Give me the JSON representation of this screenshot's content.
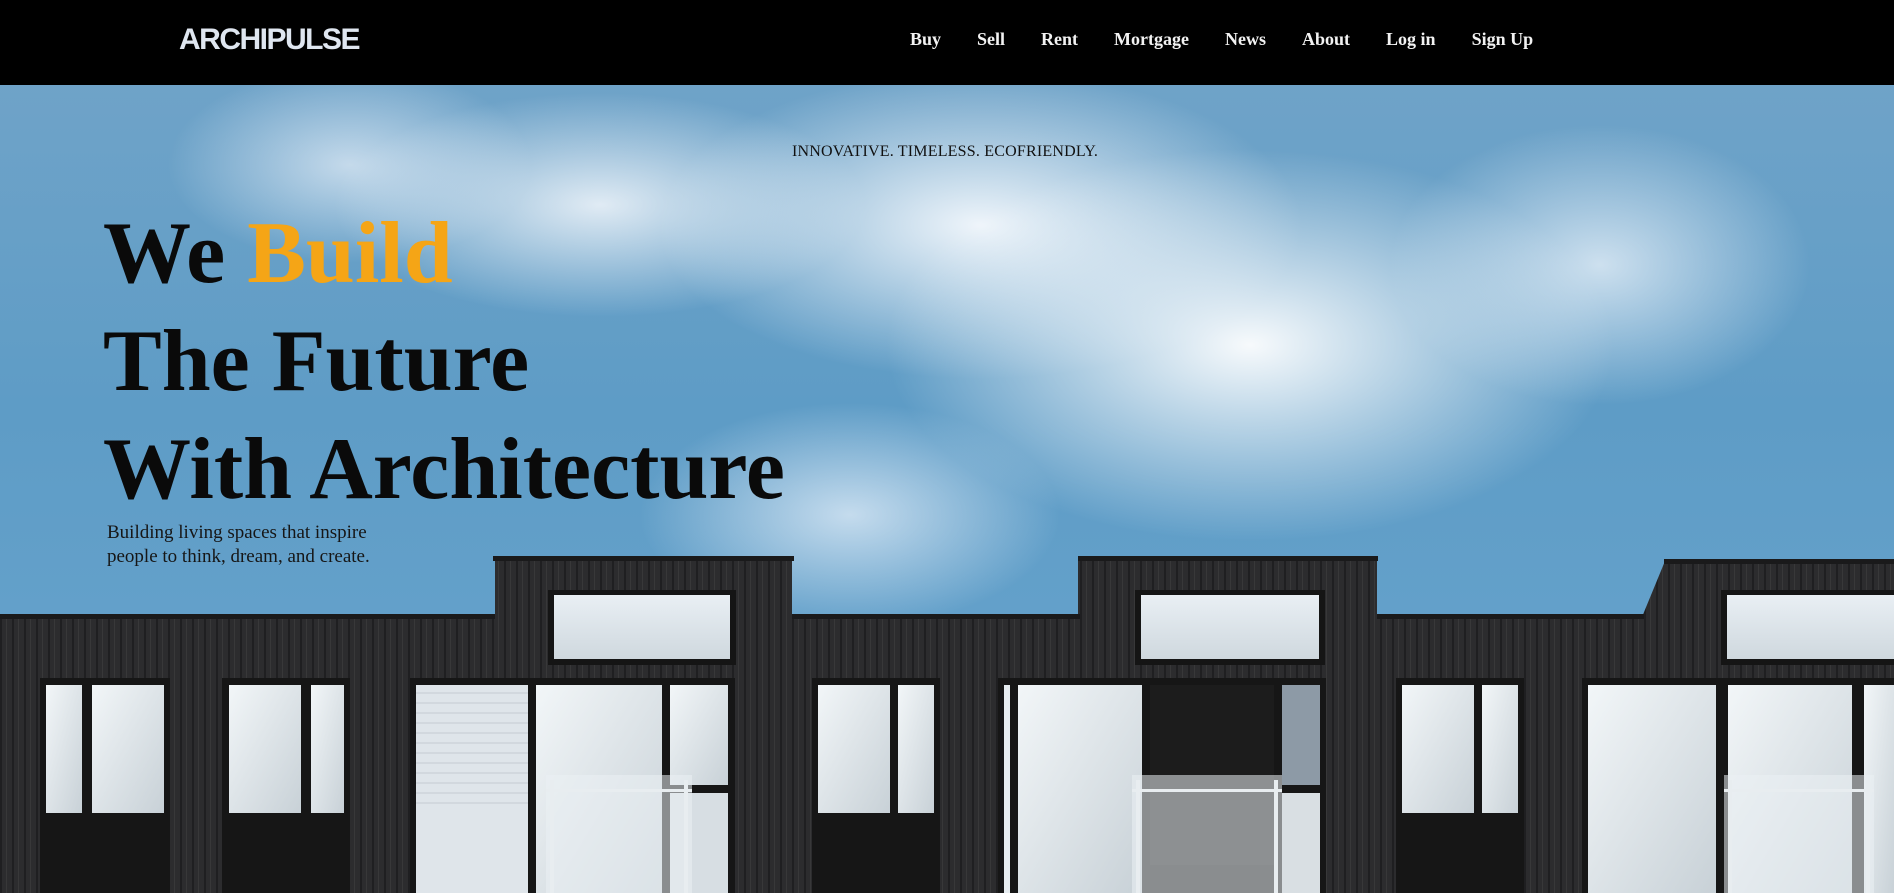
{
  "brand": {
    "logo_text": "ARCHIPULSE"
  },
  "nav": {
    "links": [
      {
        "label": "Buy"
      },
      {
        "label": "Sell"
      },
      {
        "label": "Rent"
      },
      {
        "label": "Mortgage"
      },
      {
        "label": "News"
      },
      {
        "label": "About"
      },
      {
        "label": "Log in"
      },
      {
        "label": "Sign Up"
      }
    ]
  },
  "hero": {
    "tagline": "INNOVATIVE. TIMELESS. ECOFRIENDLY.",
    "headline": {
      "line1_word1": "We",
      "line1_accent": "Build",
      "line2": "The Future",
      "line3": "With Architecture"
    },
    "subtext_line1": "Building living spaces that inspire",
    "subtext_line2": "people to think, dream, and create."
  },
  "colors": {
    "accent": "#f5a516",
    "navbar_bg": "#000000",
    "building": "#2b2b2d"
  }
}
